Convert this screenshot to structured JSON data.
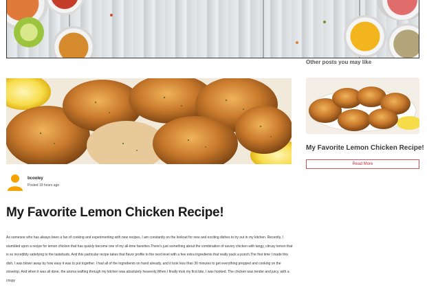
{
  "sidebar": {
    "heading": "Other posts you may like",
    "post_title": "My Favorite Lemon Chicken Recipe!",
    "read_more_label": "Read More"
  },
  "post": {
    "author": "bcooley",
    "posted": "Posted 19 hours ago",
    "title": "My Favorite Lemon Chicken Recipe!",
    "body": "As someone who has always been a fan of cooking and experimenting with new recipes, I am constantly on the lookout for new and exciting dishes to try out in my kitchen. Recently, I stumbled upon a recipe for lemon chicken that has quickly become one of my all-time favorites.There's just something about the combination of savory chicken with tangy, citrusy lemon that is so incredibly satisfying to the tastebuds. And this particular recipe takes that flavor profile to the next level with a few extra ingredients that really pack a punch.The first time I made this dish, I was blown away by how easy it was to put together. I had all of the ingredients on hand already, and it took less than 30 minutes to get everything prepped and cooking on the stovetop. And when it was all done, the aroma wafting through my kitchen was absolutely heavenly.When I finally took my first bite, I was hooked. The chicken was tender and juicy, with a crispy"
  },
  "icons": {
    "avatar": "user-avatar-icon"
  },
  "colors": {
    "read_more_border": "#d0505a",
    "read_more_text": "#c8303c",
    "avatar": "#f5a300"
  }
}
